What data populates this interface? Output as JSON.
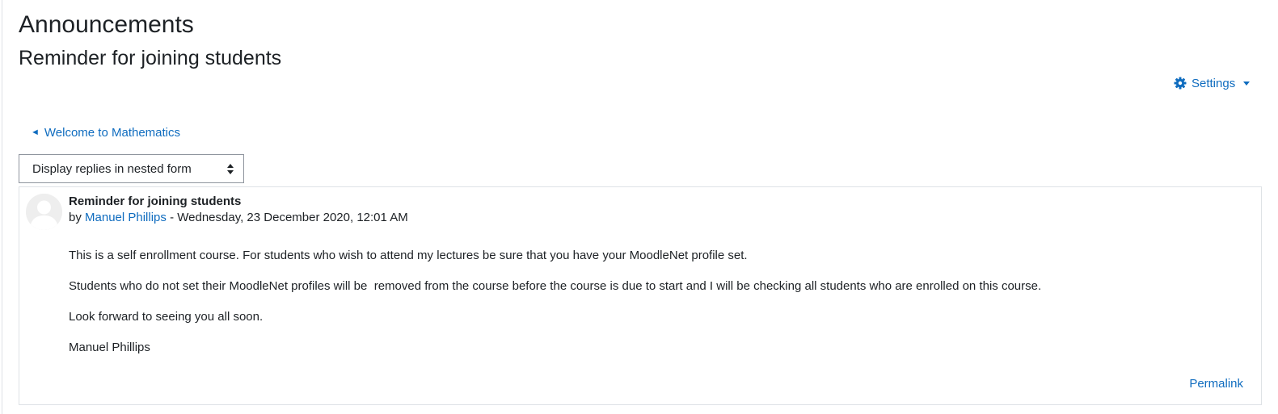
{
  "page": {
    "forum_title": "Announcements",
    "discussion_title": "Reminder for joining students"
  },
  "settings_menu": {
    "label": "Settings",
    "icon": "gear-icon"
  },
  "navigation": {
    "previous_discussion": "Welcome to Mathematics",
    "previous_icon": "left-triangle-icon"
  },
  "display_mode": {
    "selected": "Display replies in nested form"
  },
  "post": {
    "subject": "Reminder for joining students",
    "by_prefix": "by",
    "author": "Manuel Phillips",
    "separator": " - ",
    "date": "Wednesday, 23 December 2020, 12:01 AM",
    "paragraphs": [
      "This is a self enrollment course. For students who wish to attend my lectures be sure that you have your MoodleNet profile set.",
      "Students who do not set their MoodleNet profiles will be  removed from the course before the course is due to start and I will be checking all students who are enrolled on this course.",
      "Look forward to seeing you all soon.",
      "Manuel Phillips"
    ],
    "permalink_label": "Permalink"
  },
  "colors": {
    "link": "#0f6cbf",
    "text": "#1d2125",
    "border": "#dee2e6"
  }
}
